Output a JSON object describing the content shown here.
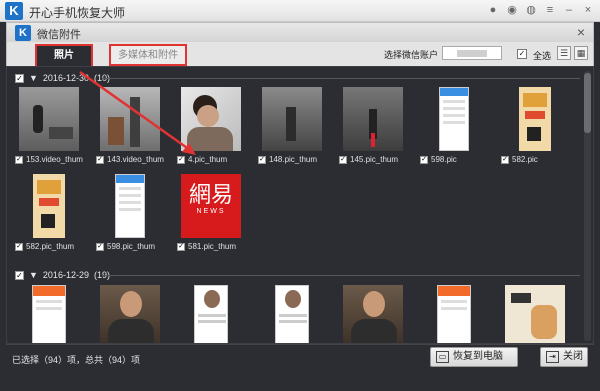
{
  "app": {
    "title": "开心手机恢复大师",
    "logo_letter": "K"
  },
  "dialog": {
    "title": "微信附件",
    "logo_letter": "K",
    "close": "×"
  },
  "tabs": [
    {
      "label": "照片"
    },
    {
      "label": "多媒体和附件"
    }
  ],
  "account": {
    "label": "选择微信账户"
  },
  "select_all": {
    "label": "全选",
    "checked": "✓"
  },
  "groups": [
    {
      "date": "2016-12-30",
      "count": "(10)",
      "items": [
        {
          "name": "153.video_thum",
          "kind": "video"
        },
        {
          "name": "143.video_thum",
          "kind": "video2"
        },
        {
          "name": "4.pic_thum",
          "kind": "person"
        },
        {
          "name": "148.pic_thum",
          "kind": "street"
        },
        {
          "name": "145.pic_thum",
          "kind": "street2"
        },
        {
          "name": "598.pic",
          "kind": "phone"
        },
        {
          "name": "582.pic",
          "kind": "poster"
        },
        {
          "name": "582.pic_thum",
          "kind": "poster"
        },
        {
          "name": "598.pic_thum",
          "kind": "phone"
        },
        {
          "name": "581.pic_thum",
          "kind": "netease"
        }
      ]
    },
    {
      "date": "2016-12-29",
      "count": "(19)",
      "items": [
        {
          "name": "",
          "kind": "doc"
        },
        {
          "name": "",
          "kind": "actor"
        },
        {
          "name": "",
          "kind": "profile"
        },
        {
          "name": "",
          "kind": "profile"
        },
        {
          "name": "",
          "kind": "actor"
        },
        {
          "name": "",
          "kind": "doc"
        },
        {
          "name": "",
          "kind": "book"
        }
      ]
    }
  ],
  "netease": {
    "logo": "網易",
    "sub": "NEWS"
  },
  "status": "已选择（94）项，总共（94）项",
  "buttons": {
    "recover": "恢复到电脑",
    "close": "关闭"
  },
  "colors": {
    "accent": "#1e73c8",
    "annotation": "#e23333",
    "content_bg": "#2b2d33"
  }
}
